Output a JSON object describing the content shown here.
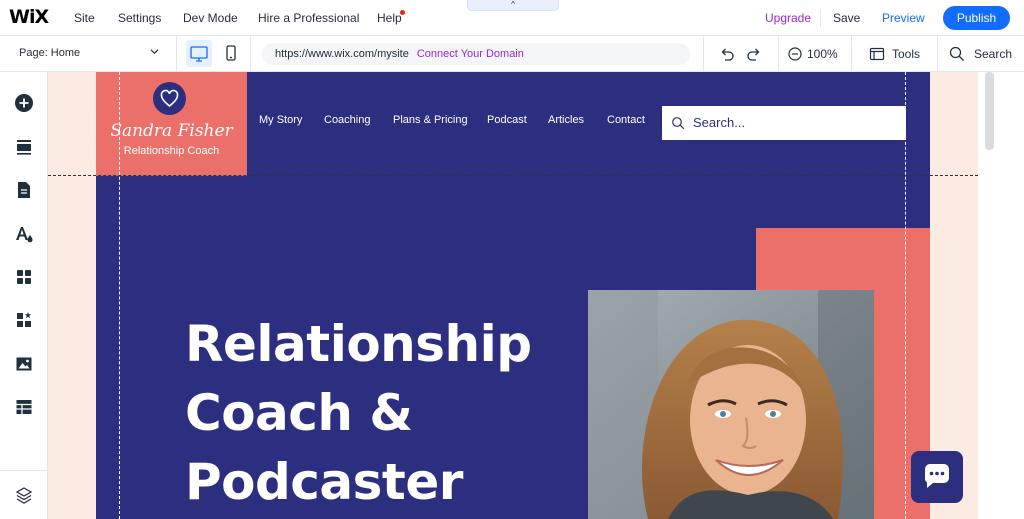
{
  "topbar": {
    "logo": "WiX",
    "menu": [
      "Site",
      "Settings",
      "Dev Mode",
      "Hire a Professional",
      "Help"
    ],
    "collapse_glyph": "^",
    "upgrade": "Upgrade",
    "save": "Save",
    "preview": "Preview",
    "publish": "Publish",
    "colors": {
      "accent": "#116dff",
      "upgrade": "#9a27d5",
      "notification": "#e62214"
    }
  },
  "toolbar": {
    "page_label": "Page: Home",
    "url": "https://www.wix.com/mysite",
    "connect_domain": "Connect Your Domain",
    "zoom": "100%",
    "tools": "Tools",
    "search": "Search",
    "icons": [
      "desktop-icon",
      "mobile-icon",
      "undo-icon",
      "redo-icon",
      "zoom-out-icon",
      "tools-icon",
      "search-icon"
    ]
  },
  "sidebar": {
    "icons": [
      "add-icon",
      "sections-icon",
      "pages-icon",
      "design-icon",
      "apps-icon",
      "business-icon",
      "media-icon",
      "cms-icon",
      "layers-icon"
    ]
  },
  "site": {
    "brand": {
      "name": "Sandra Fisher",
      "subtitle": "Relationship Coach"
    },
    "nav": [
      "My Story",
      "Coaching",
      "Plans & Pricing",
      "Podcast",
      "Articles",
      "Contact"
    ],
    "search_placeholder": "Search...",
    "headline": [
      "Relationship",
      "Coach &",
      "Podcaster"
    ],
    "colors": {
      "navy": "#2c2e7f",
      "coral": "#ec706a",
      "canvas": "#fcebe2"
    }
  }
}
